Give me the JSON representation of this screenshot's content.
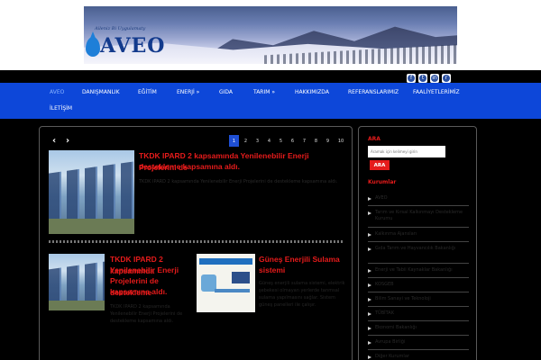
{
  "header": {
    "logo_text": "AVEO",
    "logo_slogan": "Aileniz Bi Uygulamaty"
  },
  "social": [
    "facebook-icon",
    "twitter-icon",
    "linkedin-icon",
    "rss-icon"
  ],
  "nav": {
    "items": [
      {
        "label": "AVEO",
        "active": true
      },
      {
        "label": "DANIŞMANLIK",
        "active": false
      },
      {
        "label": "EĞİTİM",
        "active": false
      },
      {
        "label": "ENERJİ »",
        "active": false
      },
      {
        "label": "GIDA",
        "active": false
      },
      {
        "label": "TARIM »",
        "active": false
      },
      {
        "label": "HAKKIMIZDA",
        "active": false
      },
      {
        "label": "REFERANSLARIMIZ",
        "active": false
      },
      {
        "label": "FAALİYETLERİMİZ",
        "active": false
      },
      {
        "label": "İLETİŞİM",
        "active": false
      }
    ],
    "accent_color": "#0d47d9"
  },
  "pager": {
    "prev": "‹",
    "next": "›",
    "pages": [
      "1",
      "2",
      "3",
      "4",
      "5",
      "6",
      "7",
      "8",
      "9",
      "10"
    ],
    "current": "1"
  },
  "featured_post": {
    "title_line1": "TKDK IPARD 2 kapsamında Yenilenebilir Enerji Projelerini de",
    "title_line2": "destekleme kapsamına aldı.",
    "excerpt": "TKDK IPARD 2 kapsamında Yenilenebilir Enerji Projelerini de destekleme kapsamına aldı."
  },
  "posts": [
    {
      "title_lines": [
        "TKDK IPARD 2 kapsamında",
        "Yenilenebilir Enerji",
        "Projelerini de destekleme",
        "kapsamına aldı."
      ],
      "excerpt": "TKDK IPARD 2 kapsamında Yenilenebilir Enerji Projelerini de destekleme kapsamına aldı."
    },
    {
      "title_lines": [
        "Güneş Enerjili Sulama",
        "sistemi"
      ],
      "excerpt": "Güneş enerjili sulama sistemi, elektrik şebekesi olmayan yerlerde tarımsal sulama yapılmasını sağlar. Sistem güneş panelleri ile çalışır."
    }
  ],
  "sidebar": {
    "search_title": "ARA",
    "search_placeholder": "Aramak için kelimeyi girin",
    "search_button": "ARA",
    "kurumlar_title": "Kurumlar",
    "items": [
      "AVEO",
      "Tarım ve Kırsal Kalkınmayı Destekleme Kurumu",
      "Kalkınma Ajansları",
      "Gıda Tarım ve Hayvancılık Bakanlığı",
      "Enerji ve Tabii Kaynaklar Bakanlığı",
      "KOSGEB",
      "Bilim Sanayi ve Teknoloji",
      "TÜBİTAK",
      "Ekonomi Bakanlığı",
      "Avrupa Birliği",
      "Diğer Kurumlar"
    ]
  },
  "colors": {
    "accent_red": "#e61b1b",
    "nav_blue": "#0d47d9",
    "pager_active": "#1f4fd4"
  }
}
